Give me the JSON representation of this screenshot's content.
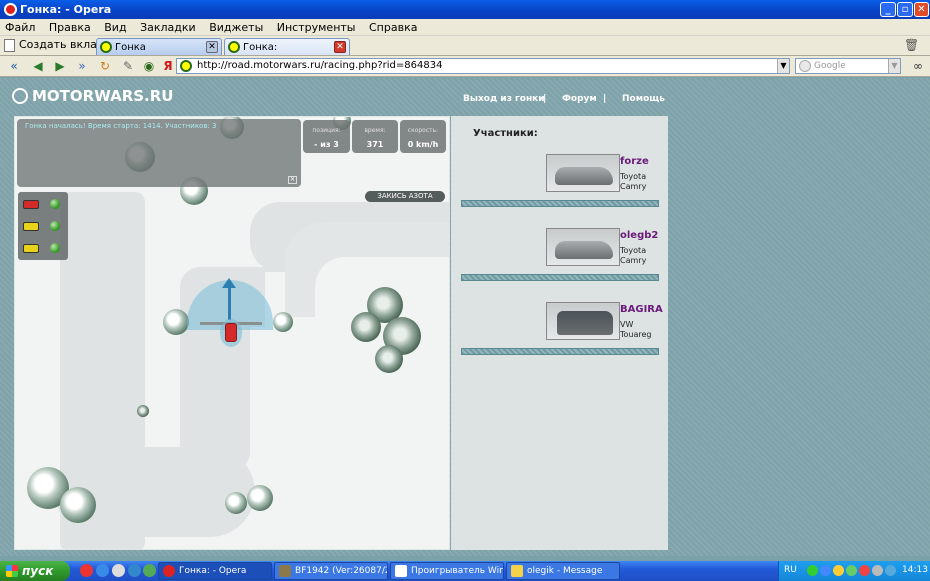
{
  "window": {
    "title": "Гонка: - Opera"
  },
  "menu": [
    "Файл",
    "Правка",
    "Вид",
    "Закладки",
    "Виджеты",
    "Инструменты",
    "Справка"
  ],
  "tabs": {
    "new_tab": "Создать вкладку",
    "items": [
      {
        "label": "Гонка"
      },
      {
        "label": "Гонка:"
      }
    ]
  },
  "address": {
    "url": "http://road.motorwars.ru/racing.php?rid=864834",
    "search_placeholder": "Google"
  },
  "site": {
    "logo": "MOTORWARS.RU",
    "nav": [
      "Выход из гонки",
      "|",
      "Форум",
      "|",
      "Помощь"
    ]
  },
  "game": {
    "message": "Гонка началась! Время старта: 1414. Участников: 3",
    "stats": [
      {
        "label": "позиция:",
        "value": "- из 3"
      },
      {
        "label": "время:",
        "value": "371"
      },
      {
        "label": "скорость:",
        "value": "0 km/h"
      }
    ],
    "nitro_button": "ЗАКИСЬ АЗОТА",
    "racers": [
      {
        "color": "#d42a2a"
      },
      {
        "color": "#e8d21a"
      },
      {
        "color": "#e8d21a"
      }
    ]
  },
  "participants": {
    "title": "Участники:",
    "list": [
      {
        "name": "forze",
        "car_make": "Toyota",
        "car_model": "Camry",
        "car_color": "#a9adaf"
      },
      {
        "name": "olegb2",
        "car_make": "Toyota",
        "car_model": "Camry",
        "car_color": "#a9adaf"
      },
      {
        "name": "BAGIRA",
        "car_make": "VW",
        "car_model": "Touareg",
        "car_color": "#4a5258"
      }
    ]
  },
  "taskbar": {
    "start": "пуск",
    "buttons": [
      {
        "label": "Гонка: - Opera",
        "active": true
      },
      {
        "label": "BF1942 (Ver:26087/2...",
        "active": false
      },
      {
        "label": "Проигрыватель Win...",
        "active": false
      },
      {
        "label": "olegik - Message",
        "active": false
      }
    ],
    "lang": "RU",
    "clock": "14:13"
  }
}
